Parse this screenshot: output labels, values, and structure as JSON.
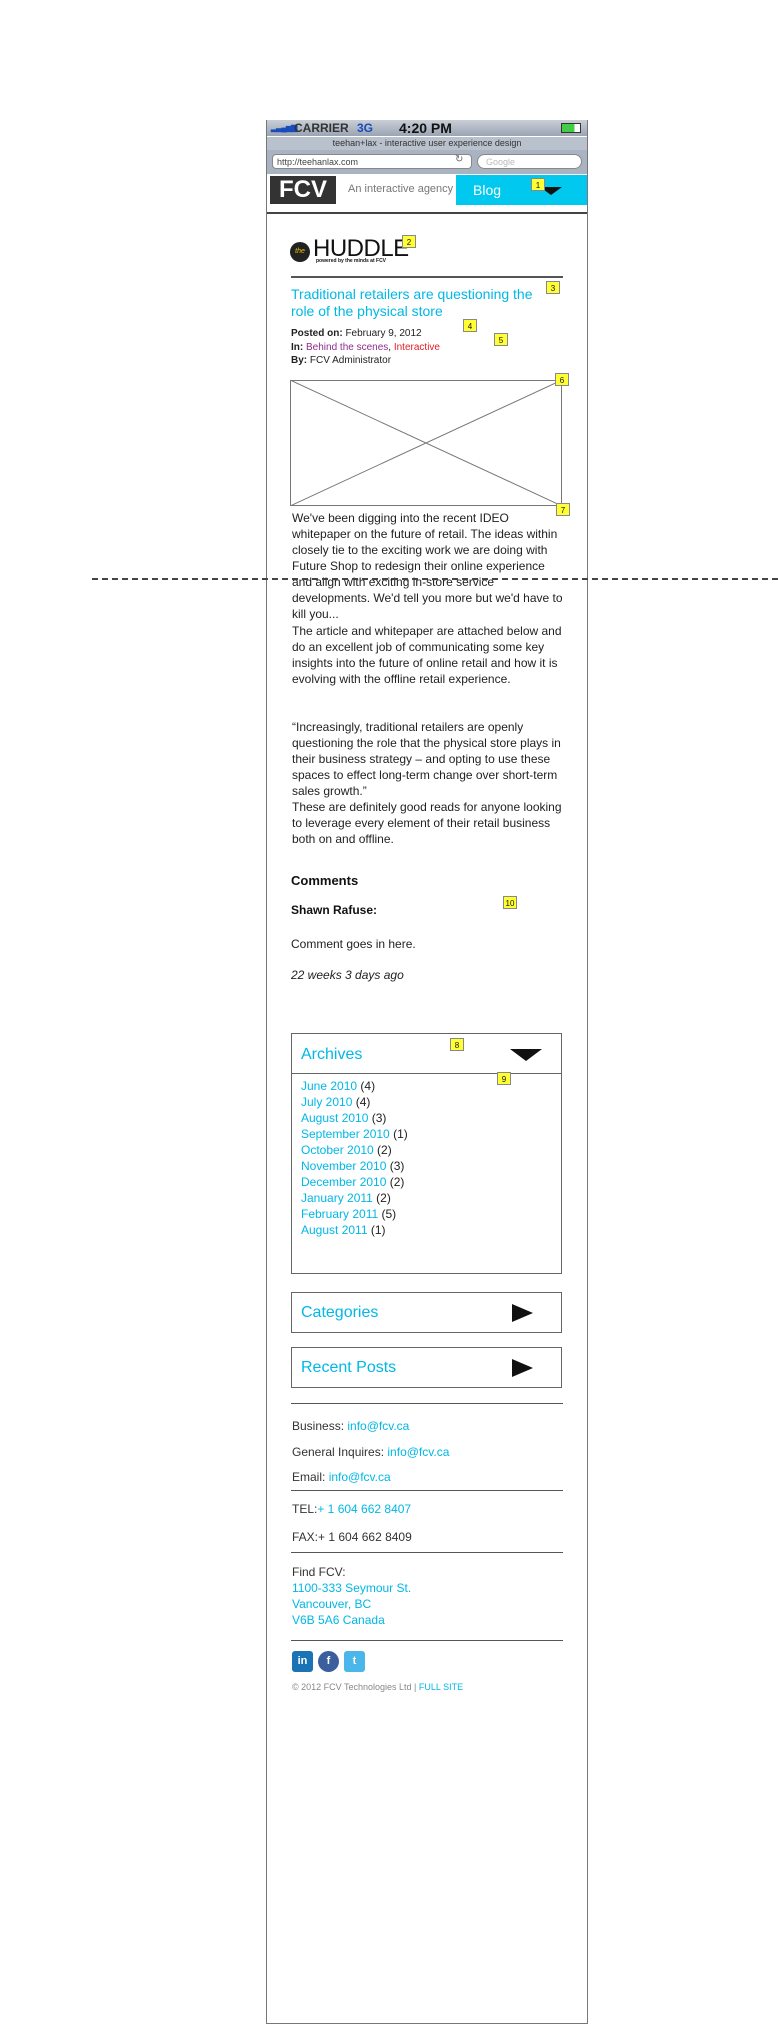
{
  "status_bar": {
    "carrier": "CARRIER",
    "network": "3G",
    "time": "4:20 PM"
  },
  "browser": {
    "page_title": "teehan+lax - interactive user experience design",
    "url": "http://teehanlax.com",
    "search_placeholder": "Google"
  },
  "header": {
    "logo": "FCV",
    "tagline": "An interactive agency",
    "nav_label": "Blog"
  },
  "annotations": [
    "1",
    "2",
    "3",
    "4",
    "5",
    "6",
    "7",
    "8",
    "9",
    "10"
  ],
  "brand": {
    "the": "the",
    "huddle": "HUDDLE",
    "sub": "powered by the minds at FCV"
  },
  "post": {
    "title": "Traditional retailers are questioning the role of the physical store",
    "posted_label": "Posted on:",
    "posted_value": " February 9, 2012",
    "in_label": "In:",
    "category1": " Behind the scenes",
    "category_sep": ",",
    "category2": " Interactive",
    "by_label": "By:",
    "by_value": " FCV Administrator",
    "paragraph1": "We've been digging into the recent IDEO whitepaper on the future of retail. The ideas within closely tie to the exciting work we are doing with Future Shop to redesign their online experience and align with exciting in-store service developments. We'd tell you more but we'd have to kill you...",
    "paragraph2": "The article and whitepaper are attached below and do an excellent job of communicating some key insights into the future of online retail and how it is evolving with the offline retail experience.",
    "quote": "“Increasingly, traditional retailers are openly questioning the role that the physical store plays in their business strategy – and opting to use these spaces to effect long-term change over short-term sales growth.”",
    "paragraph3": "These are definitely good reads for anyone looking to leverage every element of their retail business both on and offline."
  },
  "comments": {
    "heading": "Comments",
    "author": "Shawn Rafuse:",
    "text": "Comment goes in here.",
    "time": "22 weeks 3 days ago"
  },
  "archives": {
    "heading": "Archives",
    "items": [
      {
        "label": "June 2010",
        "count": " (4)"
      },
      {
        "label": "July 2010",
        "count": " (4)"
      },
      {
        "label": "August 2010",
        "count": " (3)"
      },
      {
        "label": "September 2010",
        "count": " (1)"
      },
      {
        "label": "October 2010",
        "count": " (2)"
      },
      {
        "label": "November 2010",
        "count": " (3)"
      },
      {
        "label": "December 2010",
        "count": " (2)"
      },
      {
        "label": "January 2011",
        "count": " (2)"
      },
      {
        "label": "February 2011",
        "count": " (5)"
      },
      {
        "label": "August 2011",
        "count": " (1)"
      }
    ]
  },
  "categories": {
    "heading": "Categories"
  },
  "recent_posts": {
    "heading": "Recent Posts"
  },
  "footer": {
    "business_label": "Business: ",
    "business_email": "info@fcv.ca",
    "general_label": "General Inquires: ",
    "general_email": "info@fcv.ca",
    "email_label": "Email: ",
    "email_value": "info@fcv.ca",
    "tel_label": "TEL:",
    "tel_value": "+ 1 604 662 8407",
    "fax": "FAX:+ 1 604 662 8409",
    "find_label": "Find FCV:",
    "address1": "1100-333 Seymour St.",
    "address2": "Vancouver, BC",
    "address3": "V6B 5A6 Canada",
    "copyright": "© 2012 FCV Technologies Ltd | ",
    "full_site": "FULL SITE"
  },
  "social": [
    "in",
    "f",
    "t"
  ],
  "colors": {
    "accent": "#00c8ef",
    "link": "#00b8e6",
    "category1": "#8e2b8e",
    "category2": "#e0202a",
    "badge": "#ffff33"
  }
}
